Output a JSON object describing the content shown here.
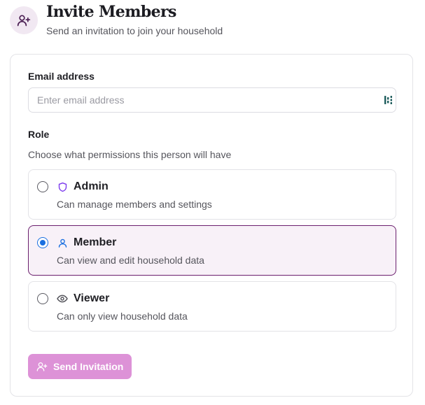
{
  "header": {
    "title": "Invite Members",
    "subtitle": "Send an invitation to join your household",
    "icon": "user-plus-icon"
  },
  "form": {
    "email": {
      "label": "Email address",
      "placeholder": "Enter email address",
      "value": ""
    },
    "role": {
      "label": "Role",
      "description": "Choose what permissions this person will have",
      "selected": "member",
      "options": [
        {
          "id": "admin",
          "title": "Admin",
          "description": "Can manage members and settings",
          "icon": "shield-icon"
        },
        {
          "id": "member",
          "title": "Member",
          "description": "Can view and edit household data",
          "icon": "user-icon"
        },
        {
          "id": "viewer",
          "title": "Viewer",
          "description": "Can only view household data",
          "icon": "eye-icon"
        }
      ]
    },
    "submit_label": "Send Invitation",
    "submit_disabled": true
  },
  "colors": {
    "brand": "#6b1f6e",
    "radio_selected": "#1a6fe0",
    "admin_icon": "#7c3aed",
    "member_icon": "#1a6fe0",
    "button_disabled_bg": "#dd92d7"
  }
}
